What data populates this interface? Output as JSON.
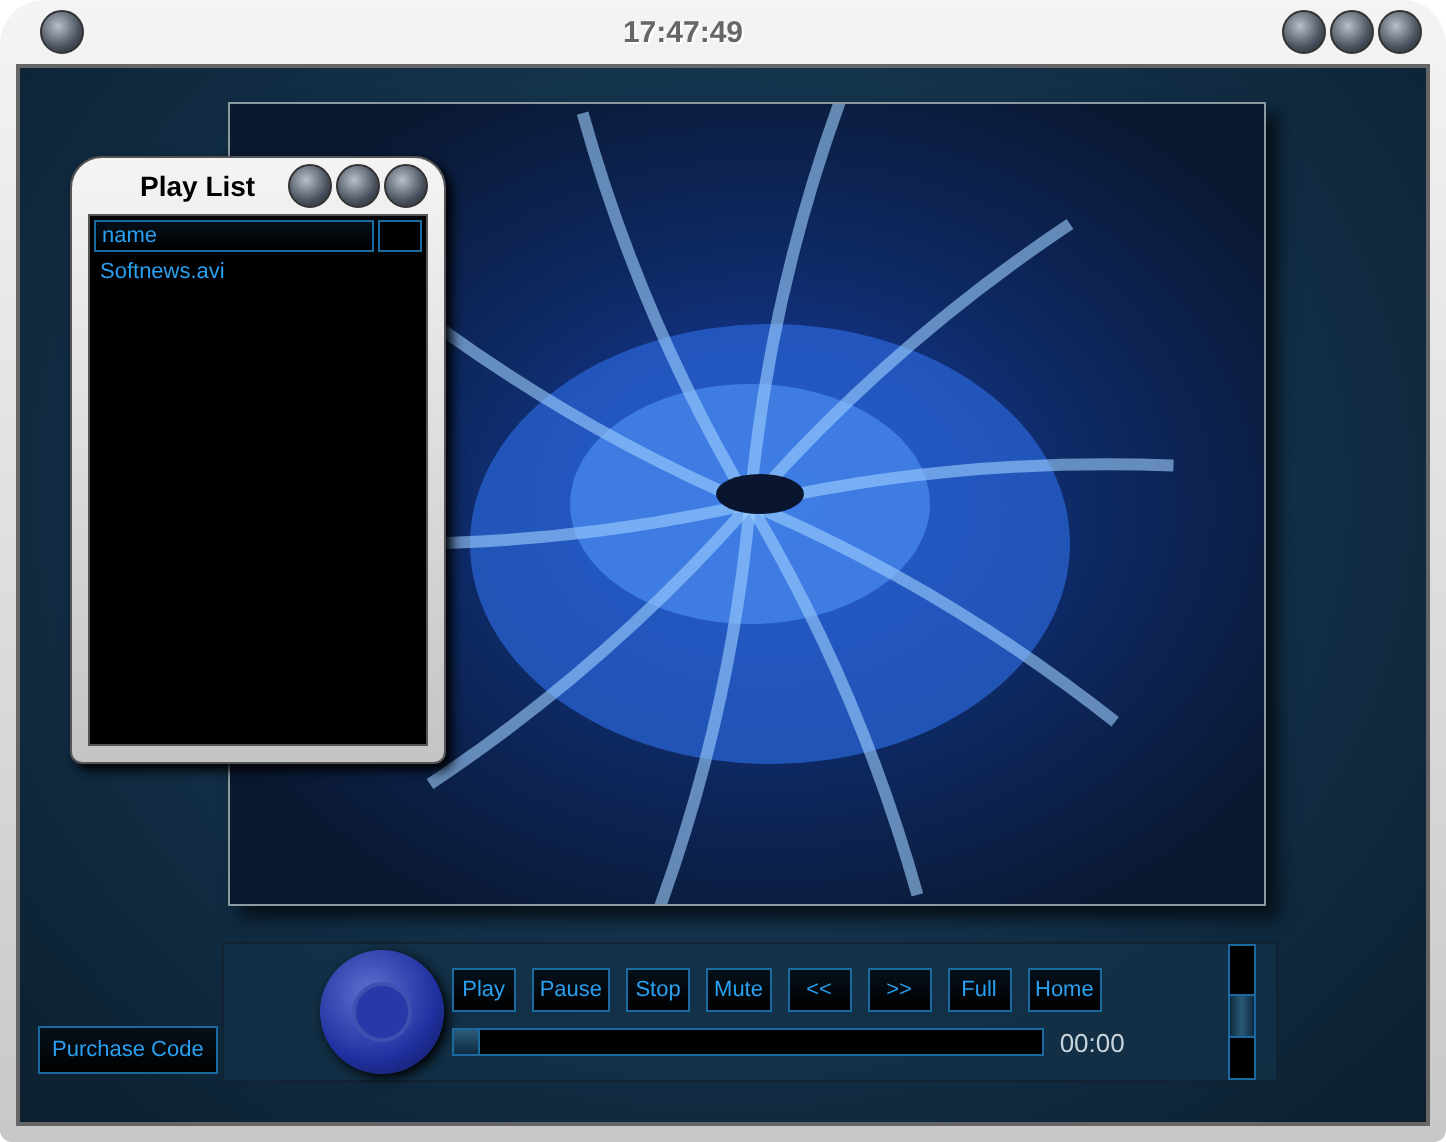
{
  "window": {
    "title": "17:47:49"
  },
  "playlist": {
    "title": "Play List",
    "column": "name",
    "items": [
      {
        "name": "Softnews.avi"
      }
    ]
  },
  "controls": {
    "buttons": [
      "Play",
      "Pause",
      "Stop",
      "Mute",
      "<<",
      ">>",
      "Full",
      "Home"
    ],
    "progress": {
      "level": 0.04
    },
    "time": "00:00",
    "volume": {
      "level": 0.45
    }
  },
  "purchase_button": "Purchase Code"
}
